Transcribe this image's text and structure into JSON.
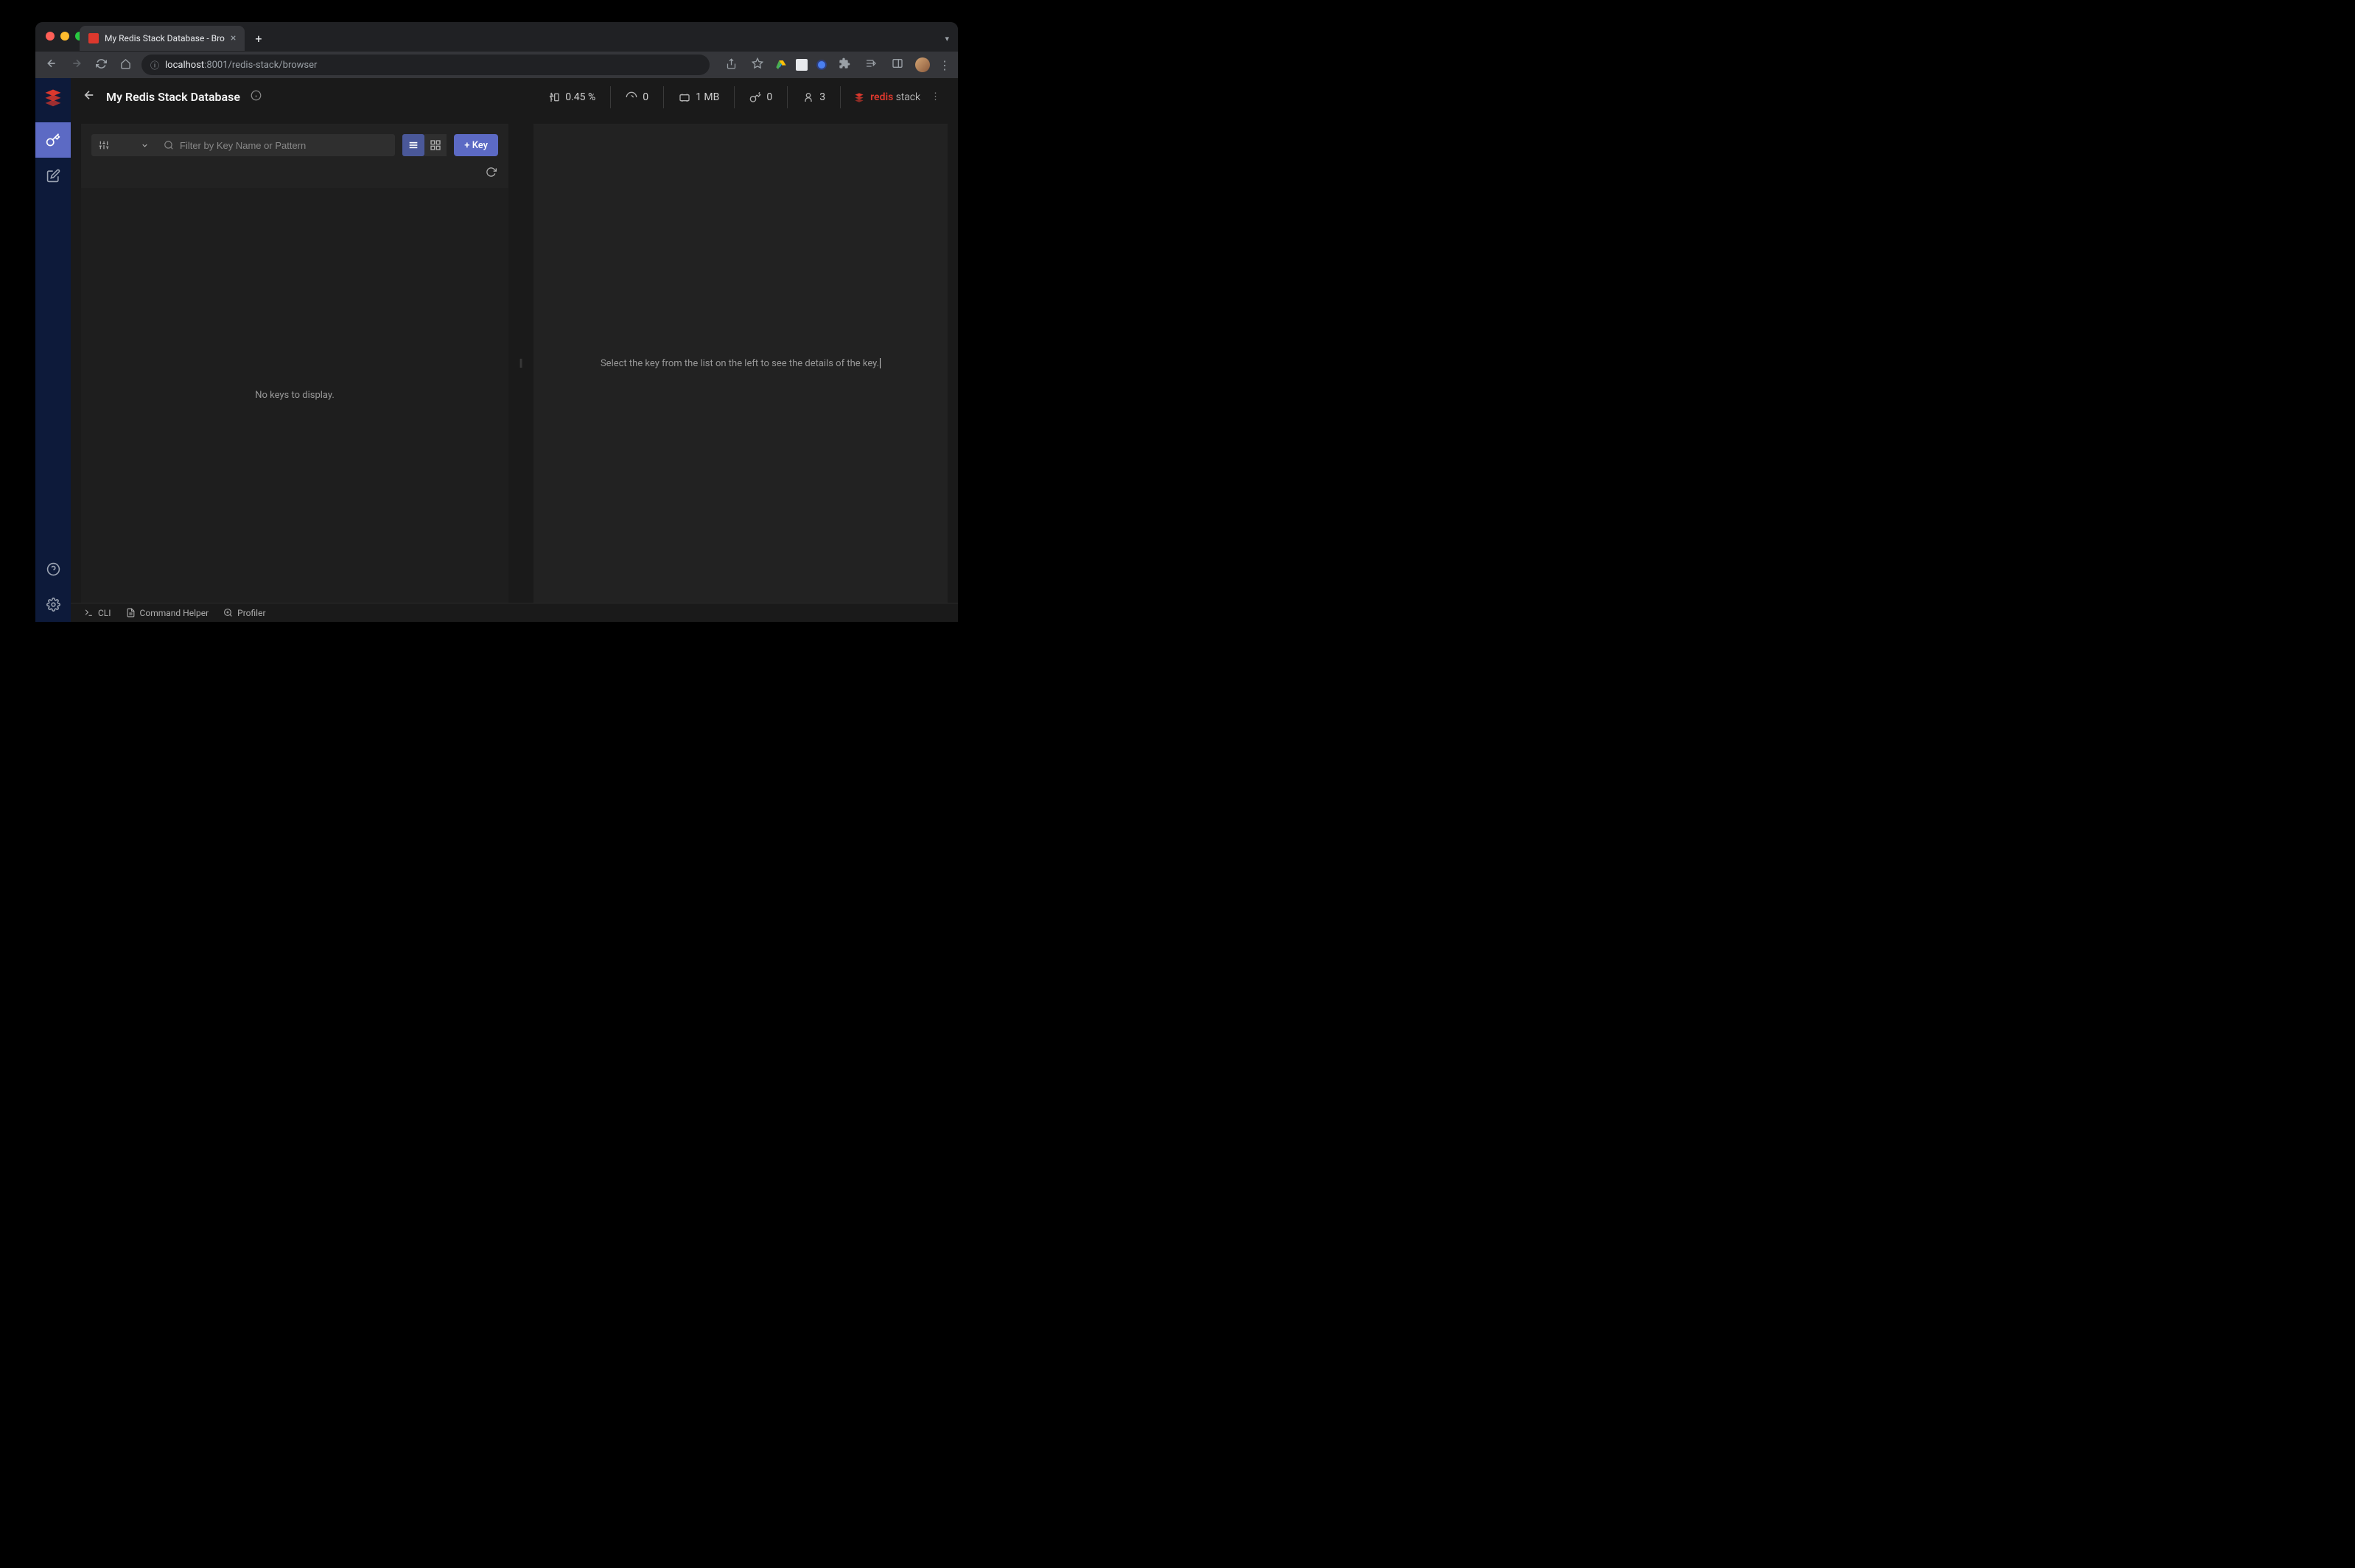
{
  "window": {
    "tab_title": "My Redis Stack Database - Bro",
    "url_display": {
      "host": "localhost",
      "port_path": ":8001/redis-stack/browser"
    }
  },
  "header": {
    "title": "My Redis Stack Database",
    "stats": {
      "cpu": "0.45 %",
      "throughput": "0",
      "memory": "1 MB",
      "keys": "0",
      "clients": "3"
    },
    "brand_red": "redis",
    "brand_stack": "stack"
  },
  "browser": {
    "filter_placeholder": "Filter by Key Name or Pattern",
    "add_key_label": "+ Key",
    "empty_message": "No keys to display.",
    "detail_placeholder": "Select the key from the list on the left to see the details of the key."
  },
  "bottombar": {
    "cli": "CLI",
    "command_helper": "Command Helper",
    "profiler": "Profiler"
  }
}
